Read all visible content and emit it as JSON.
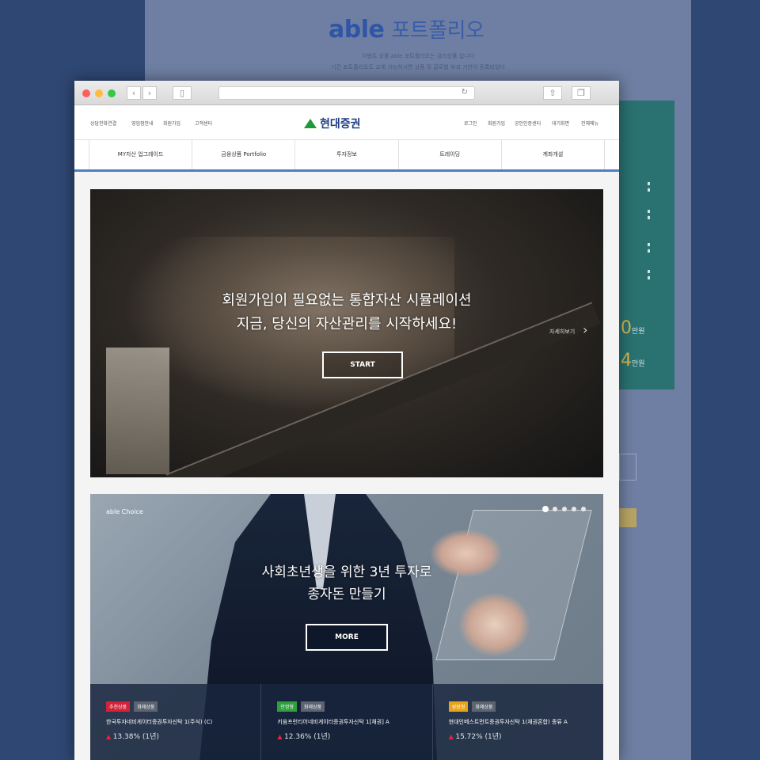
{
  "background": {
    "brand": "able",
    "title_rest": "포트폴리오",
    "sub1": "이벤트 상품 able 포트폴리오는 금리상품 입니다",
    "sub2": "기간 포트폴리오도 교체 가능하시면 상품 및 글로벌 부과 기한이 등록되었다",
    "numbers": [
      {
        "value": "0",
        "unit": "만원"
      },
      {
        "value": "4",
        "unit": "만원"
      }
    ]
  },
  "browser": {
    "url": ""
  },
  "site": {
    "util_left": [
      "상담전화연결",
      "영업점안내",
      "회원가입",
      "고객센터"
    ],
    "logo": "현대증권",
    "util_right": [
      "로그인",
      "회원가입",
      "공인인증센터",
      "대기화면",
      "전체메뉴"
    ],
    "gnb": [
      "MY자산 업그레이드",
      "금융상품 Portfolio",
      "투자정보",
      "트레이딩",
      "계좌개설"
    ]
  },
  "hero": {
    "line1": "회원가입이 필요없는 통합자산 시뮬레이션",
    "line2": "지금, 당신의 자산관리를 시작하세요!",
    "button": "START",
    "side_label": "자세히보기"
  },
  "banner2": {
    "label": "able Choice",
    "line1": "사회초년생을 위한 3년 투자로",
    "line2": "종자돈 만들기",
    "button": "MORE",
    "dots": 5
  },
  "funds": [
    {
      "tag": "추천상품",
      "tag_color": "#d3223a",
      "tag2": "화제상품",
      "name": "한국투자네비게이터증권투자신탁 1(주식) (C)",
      "rate": "13.38% (1년)"
    },
    {
      "tag": "안정형",
      "tag_color": "#2e9e3f",
      "tag2": "화제상품",
      "name": "키움프런티어네비게이터증권투자신탁 1[채권] A",
      "rate": "12.36% (1년)"
    },
    {
      "tag": "성장형",
      "tag_color": "#e6a418",
      "tag2": "화제상품",
      "name": "현대인베스트먼트증권투자신탁 1(채권혼합) 종류 A",
      "rate": "15.72% (1년)"
    }
  ]
}
